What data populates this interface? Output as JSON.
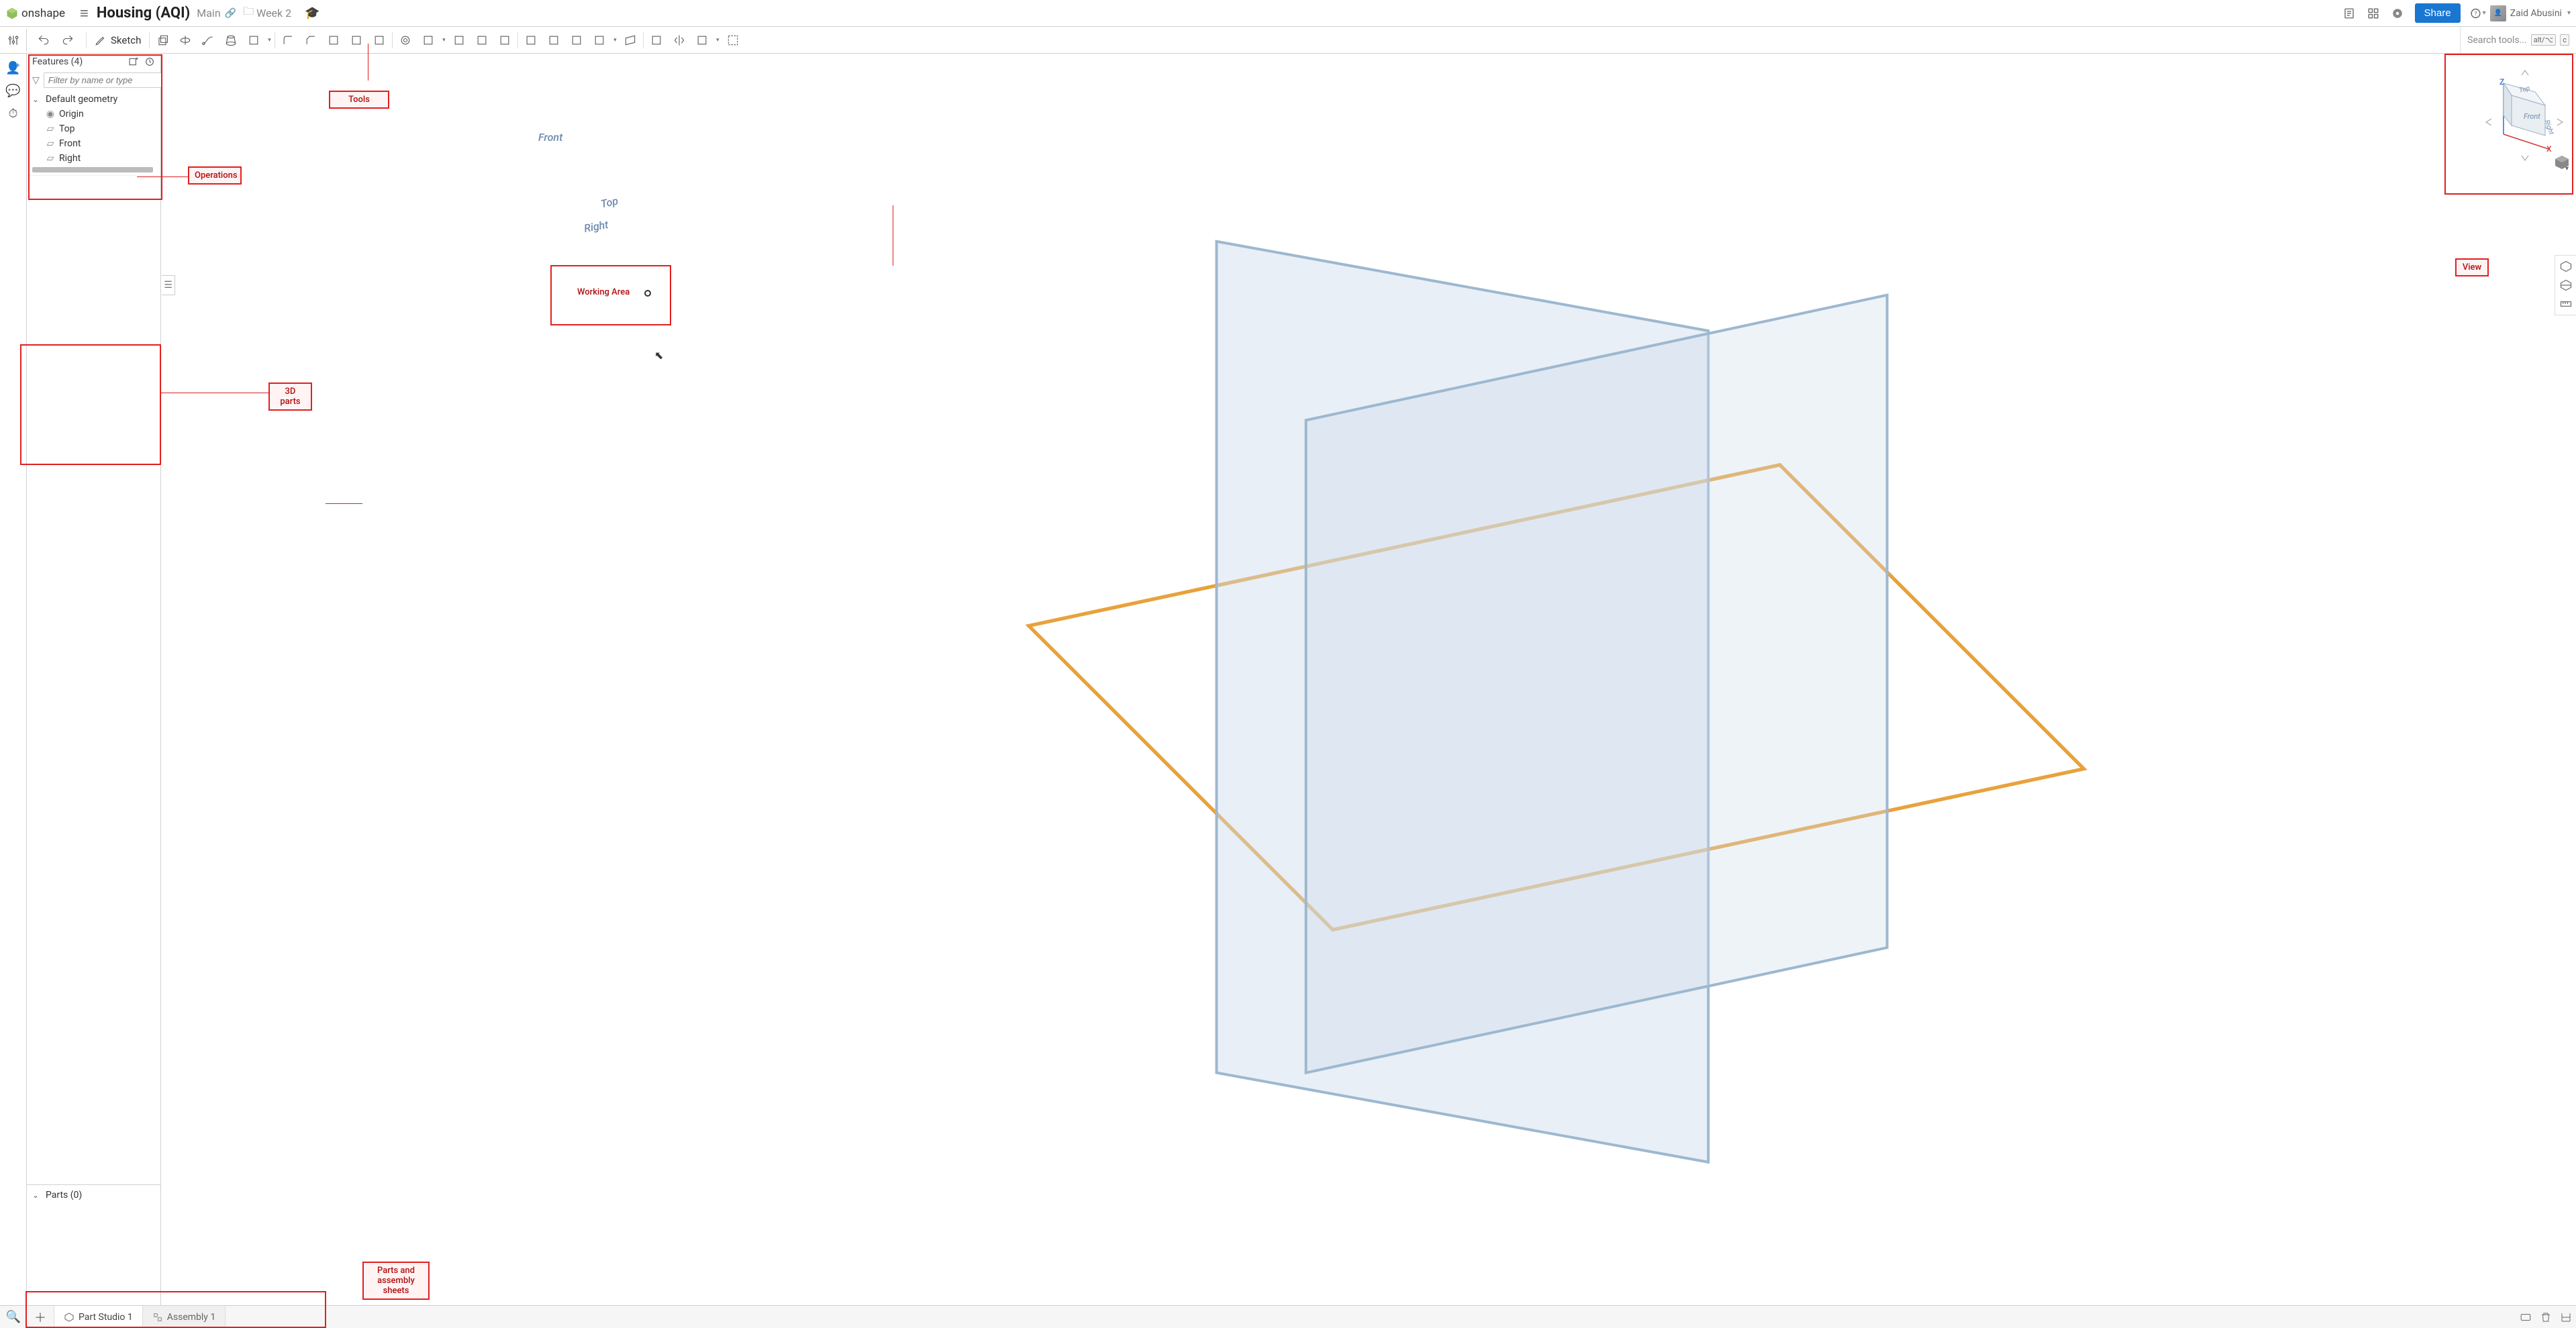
{
  "header": {
    "app_name": "onshape",
    "doc_title": "Housing (AQI)",
    "branch": "Main",
    "breadcrumb_folder": "Week 2",
    "share_label": "Share",
    "user_name": "Zaid Abusini"
  },
  "toolbar": {
    "sketch_label": "Sketch",
    "search_placeholder": "Search tools...",
    "search_shortcut_mod": "alt/⌥",
    "search_shortcut_key": "c",
    "tools": [
      "extrude",
      "revolve",
      "sweep",
      "loft",
      "thicken",
      "fillet",
      "chamfer",
      "draft",
      "shell",
      "rib",
      "hole",
      "boolean",
      "split",
      "transform",
      "delete-face",
      "move-face",
      "replace-face",
      "offset-surface",
      "boundary-surface",
      "plane",
      "helix",
      "mirror",
      "pattern",
      "frame-select"
    ]
  },
  "features": {
    "title": "Features (4)",
    "filter_placeholder": "Filter by name or type",
    "default_geometry_label": "Default geometry",
    "items": [
      {
        "icon": "origin",
        "label": "Origin"
      },
      {
        "icon": "plane",
        "label": "Top"
      },
      {
        "icon": "plane",
        "label": "Front"
      },
      {
        "icon": "plane",
        "label": "Right"
      }
    ]
  },
  "parts": {
    "title": "Parts (0)"
  },
  "canvas": {
    "plane_labels": {
      "front": "Front",
      "top": "Top",
      "right": "Right"
    },
    "axes": {
      "x": "X",
      "z": "Z"
    },
    "cube_faces": {
      "front": "Front",
      "top": "Top",
      "right": "Right"
    }
  },
  "annotations": {
    "tools": "Tools",
    "operations": "Operations",
    "working_area": "Working Area",
    "parts_3d": "3D parts",
    "view": "View",
    "parts_assembly": "Parts and\nassembly sheets"
  },
  "tabs": {
    "part_studio": "Part Studio 1",
    "assembly": "Assembly 1"
  }
}
